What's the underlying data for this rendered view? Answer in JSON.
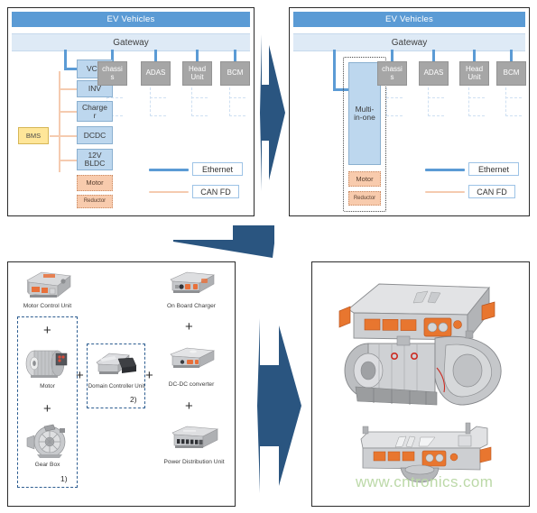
{
  "diagram_left": {
    "title": "EV Vehicles",
    "gateway": "Gateway",
    "nodes": [
      {
        "id": "vcu",
        "label": "VCU"
      },
      {
        "id": "inv",
        "label": "INV"
      },
      {
        "id": "charger",
        "label": "Charge\nr"
      },
      {
        "id": "dcdc",
        "label": "DCDC"
      },
      {
        "id": "bldc",
        "label": "12V\nBLDC"
      },
      {
        "id": "motor",
        "label": "Motor"
      },
      {
        "id": "reductor",
        "label": "Reductor"
      },
      {
        "id": "bms",
        "label": "BMS"
      }
    ],
    "ecus": [
      {
        "id": "chassis",
        "label": "chassi\ns"
      },
      {
        "id": "adas",
        "label": "ADAS"
      },
      {
        "id": "headunit",
        "label": "Head\nUnit"
      },
      {
        "id": "bcm",
        "label": "BCM"
      }
    ],
    "legend": [
      {
        "id": "ethernet",
        "label": "Ethernet",
        "color": "#5b9bd5"
      },
      {
        "id": "canfd",
        "label": "CAN FD",
        "color": "#f5cbb0"
      }
    ]
  },
  "diagram_right": {
    "title": "EV Vehicles",
    "gateway": "Gateway",
    "nodes": [
      {
        "id": "multiinone",
        "label": "Multi-\nin-one"
      },
      {
        "id": "motor",
        "label": "Motor"
      },
      {
        "id": "reductor",
        "label": "Reductor"
      }
    ],
    "ecus": [
      {
        "id": "chassis",
        "label": "chassi\ns"
      },
      {
        "id": "adas",
        "label": "ADAS"
      },
      {
        "id": "headunit",
        "label": "Head\nUnit"
      },
      {
        "id": "bcm",
        "label": "BCM"
      }
    ],
    "legend": [
      {
        "id": "ethernet",
        "label": "Ethernet",
        "color": "#5b9bd5"
      },
      {
        "id": "canfd",
        "label": "CAN FD",
        "color": "#f5cbb0"
      }
    ]
  },
  "components": {
    "items": [
      {
        "id": "motor-control-unit",
        "label": "Motor Control Unit"
      },
      {
        "id": "motor",
        "label": "Motor"
      },
      {
        "id": "gear-box",
        "label": "Gear Box"
      },
      {
        "id": "domain-controller-unit",
        "label": "Domain Controller Unit"
      },
      {
        "id": "on-board-charger",
        "label": "On Board Charger"
      },
      {
        "id": "dc-dc-converter",
        "label": "DC-DC converter"
      },
      {
        "id": "power-distribution-unit",
        "label": "Power Distribution Unit"
      }
    ],
    "plus_symbol": "+",
    "group_numbers": [
      "1)",
      "2)"
    ]
  },
  "watermark": {
    "text": "www.cntronics.com",
    "color": "#bcd9a8"
  },
  "colors": {
    "title_blue": "#5b9bd5",
    "gateway_blue": "#deeaf6",
    "node_blue": "#bdd7ee",
    "node_gray": "#a6a6a6",
    "node_yellow": "#ffe699",
    "node_orange": "#f8cbad",
    "arrow_blue": "#2a5580",
    "group_dash": "#2e5e91"
  }
}
